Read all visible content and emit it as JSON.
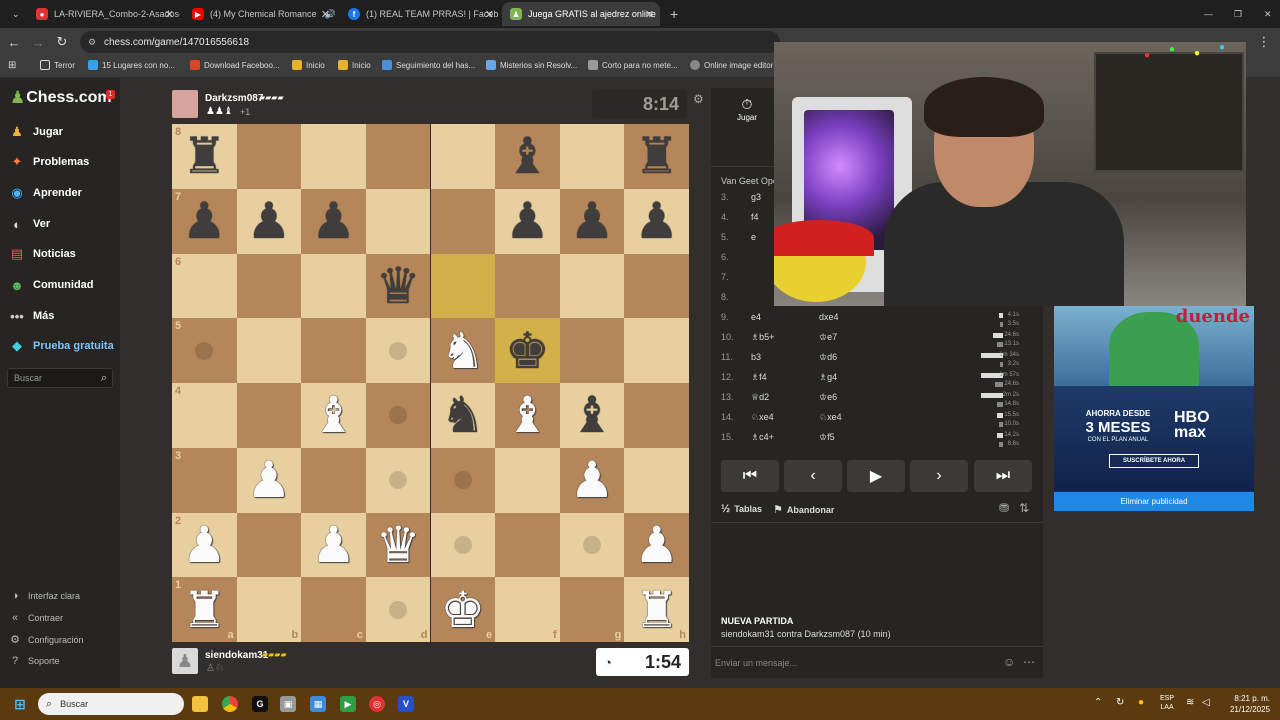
{
  "browser": {
    "tabs": [
      {
        "label": "LA-RIVIERA_Combo-2-Asados-",
        "favicon": "red"
      },
      {
        "label": "(4) My Chemical Romance",
        "favicon": "youtube"
      },
      {
        "label": "(1) REAL TEAM PRRAS! | Faceb",
        "favicon": "facebook"
      },
      {
        "label": "Juega GRATIS al ajedrez online",
        "favicon": "chess"
      }
    ],
    "url": "chess.com/game/147016556618",
    "bookmarks": [
      "Terror",
      "15 Lugares con no...",
      "Download Faceboo...",
      "Inicio",
      "Inicio",
      "Seguimiento del has...",
      "Misterios sin Resolv...",
      "Corto para no mete...",
      "Online image editor"
    ]
  },
  "sidebar": {
    "logo": "Chess.com",
    "badge": "1",
    "items": [
      {
        "label": "Jugar",
        "icon": "play-icon"
      },
      {
        "label": "Problemas",
        "icon": "puzzle-icon"
      },
      {
        "label": "Aprender",
        "icon": "learn-icon"
      },
      {
        "label": "Ver",
        "icon": "watch-icon"
      },
      {
        "label": "Noticias",
        "icon": "news-icon"
      },
      {
        "label": "Comunidad",
        "icon": "community-icon"
      },
      {
        "label": "Más",
        "icon": "more-icon"
      },
      {
        "label": "Prueba gratuita",
        "icon": "diamond-icon"
      }
    ],
    "search_placeholder": "Buscar",
    "footer": [
      {
        "label": "Interfaz clara",
        "icon": "theme-icon"
      },
      {
        "label": "Contraer",
        "icon": "collapse-icon"
      },
      {
        "label": "Configuración",
        "icon": "settings-icon"
      },
      {
        "label": "Soporte",
        "icon": "help-icon"
      }
    ]
  },
  "game": {
    "top_player": {
      "name": "Darkzsm087",
      "captured": "+1",
      "clock": "8:14"
    },
    "bottom_player": {
      "name": "siendokam31",
      "clock": "1:54"
    },
    "files": [
      "a",
      "b",
      "c",
      "d",
      "e",
      "f",
      "g",
      "h"
    ],
    "ranks": [
      "8",
      "7",
      "6",
      "5",
      "4",
      "3",
      "2",
      "1"
    ],
    "pieces": [
      {
        "sq": "a8",
        "p": "♜",
        "c": "b"
      },
      {
        "sq": "f8",
        "p": "♝",
        "c": "b"
      },
      {
        "sq": "h8",
        "p": "♜",
        "c": "b"
      },
      {
        "sq": "a7",
        "p": "♟",
        "c": "b"
      },
      {
        "sq": "b7",
        "p": "♟",
        "c": "b"
      },
      {
        "sq": "c7",
        "p": "♟",
        "c": "b"
      },
      {
        "sq": "f7",
        "p": "♟",
        "c": "b"
      },
      {
        "sq": "g7",
        "p": "♟",
        "c": "b"
      },
      {
        "sq": "h7",
        "p": "♟",
        "c": "b"
      },
      {
        "sq": "d6",
        "p": "♛",
        "c": "b"
      },
      {
        "sq": "e5",
        "p": "♞",
        "c": "w"
      },
      {
        "sq": "f5",
        "p": "♚",
        "c": "b"
      },
      {
        "sq": "c4",
        "p": "♝",
        "c": "w"
      },
      {
        "sq": "e4",
        "p": "♞",
        "c": "b"
      },
      {
        "sq": "f4",
        "p": "♝",
        "c": "w"
      },
      {
        "sq": "g4",
        "p": "♝",
        "c": "b"
      },
      {
        "sq": "b3",
        "p": "♟",
        "c": "w"
      },
      {
        "sq": "g3",
        "p": "♟",
        "c": "w"
      },
      {
        "sq": "a2",
        "p": "♟",
        "c": "w"
      },
      {
        "sq": "c2",
        "p": "♟",
        "c": "w"
      },
      {
        "sq": "d2",
        "p": "♛",
        "c": "w"
      },
      {
        "sq": "h2",
        "p": "♟",
        "c": "w"
      },
      {
        "sq": "a1",
        "p": "♜",
        "c": "w"
      },
      {
        "sq": "e1",
        "p": "♚",
        "c": "w"
      },
      {
        "sq": "h1",
        "p": "♜",
        "c": "w"
      }
    ],
    "highlights": [
      "e6",
      "f5"
    ],
    "hints": [
      "a5",
      "d5",
      "d4",
      "d3",
      "e3",
      "e2",
      "g2",
      "d1"
    ]
  },
  "panel": {
    "tab_label": "Jugar",
    "opening": "Van Geet Ope",
    "moves": [
      {
        "n": "3.",
        "w": "g3",
        "b": ""
      },
      {
        "n": "4.",
        "w": "f4",
        "b": ""
      },
      {
        "n": "5.",
        "w": "e",
        "b": ""
      },
      {
        "n": "6.",
        "w": "",
        "b": ""
      },
      {
        "n": "7.",
        "w": "",
        "b": ""
      },
      {
        "n": "8.",
        "w": "",
        "b": ""
      },
      {
        "n": "9.",
        "w": "e4",
        "b": "dxe4",
        "t1": "4.1s",
        "t2": "3.5s",
        "b1": 4,
        "b2": 3
      },
      {
        "n": "10.",
        "w": "♗b5+",
        "b": "♔e7",
        "t1": "24.6s",
        "t2": "13.1s",
        "b1": 10,
        "b2": 6
      },
      {
        "n": "11.",
        "w": "b3",
        "b": "♔d6",
        "t1": "1m 34s",
        "t2": "3.2s",
        "b1": 22,
        "b2": 3
      },
      {
        "n": "12.",
        "w": "♗f4",
        "b": "♗g4",
        "t1": "1m 57s",
        "t2": "24.6s",
        "b1": 22,
        "b2": 8
      },
      {
        "n": "13.",
        "w": "♕d2",
        "b": "♔e6",
        "t1": "2m 2s",
        "t2": "14.8s",
        "b1": 22,
        "b2": 6
      },
      {
        "n": "14.",
        "w": "♘xe4",
        "b": "♘xe4",
        "t1": "15.5s",
        "t2": "10.0s",
        "b1": 6,
        "b2": 4
      },
      {
        "n": "15.",
        "w": "♗c4+",
        "b": "♔f5",
        "t1": "14.2s",
        "t2": "8.6s",
        "b1": 6,
        "b2": 4
      }
    ],
    "draw_label": "Tablas",
    "resign_label": "Abandonar",
    "new_game_title": "NUEVA PARTIDA",
    "new_game_desc": "siendokam31 contra Darkzsm087 (10 min)",
    "chat_placeholder": "Enviar un mensaje..."
  },
  "ad": {
    "headline": "duende",
    "promo_line1": "AHORRA DESDE",
    "promo_line2": "3 MESES",
    "promo_line3": "CON EL PLAN ANUAL",
    "brand": "HBO max",
    "cta": "SUSCRÍBETE AHORA",
    "remove": "Eliminar publicidad"
  },
  "taskbar": {
    "search": "Buscar",
    "lang1": "ESP",
    "lang2": "LAA",
    "time": "8:21 p. m.",
    "date": "21/12/2025"
  }
}
